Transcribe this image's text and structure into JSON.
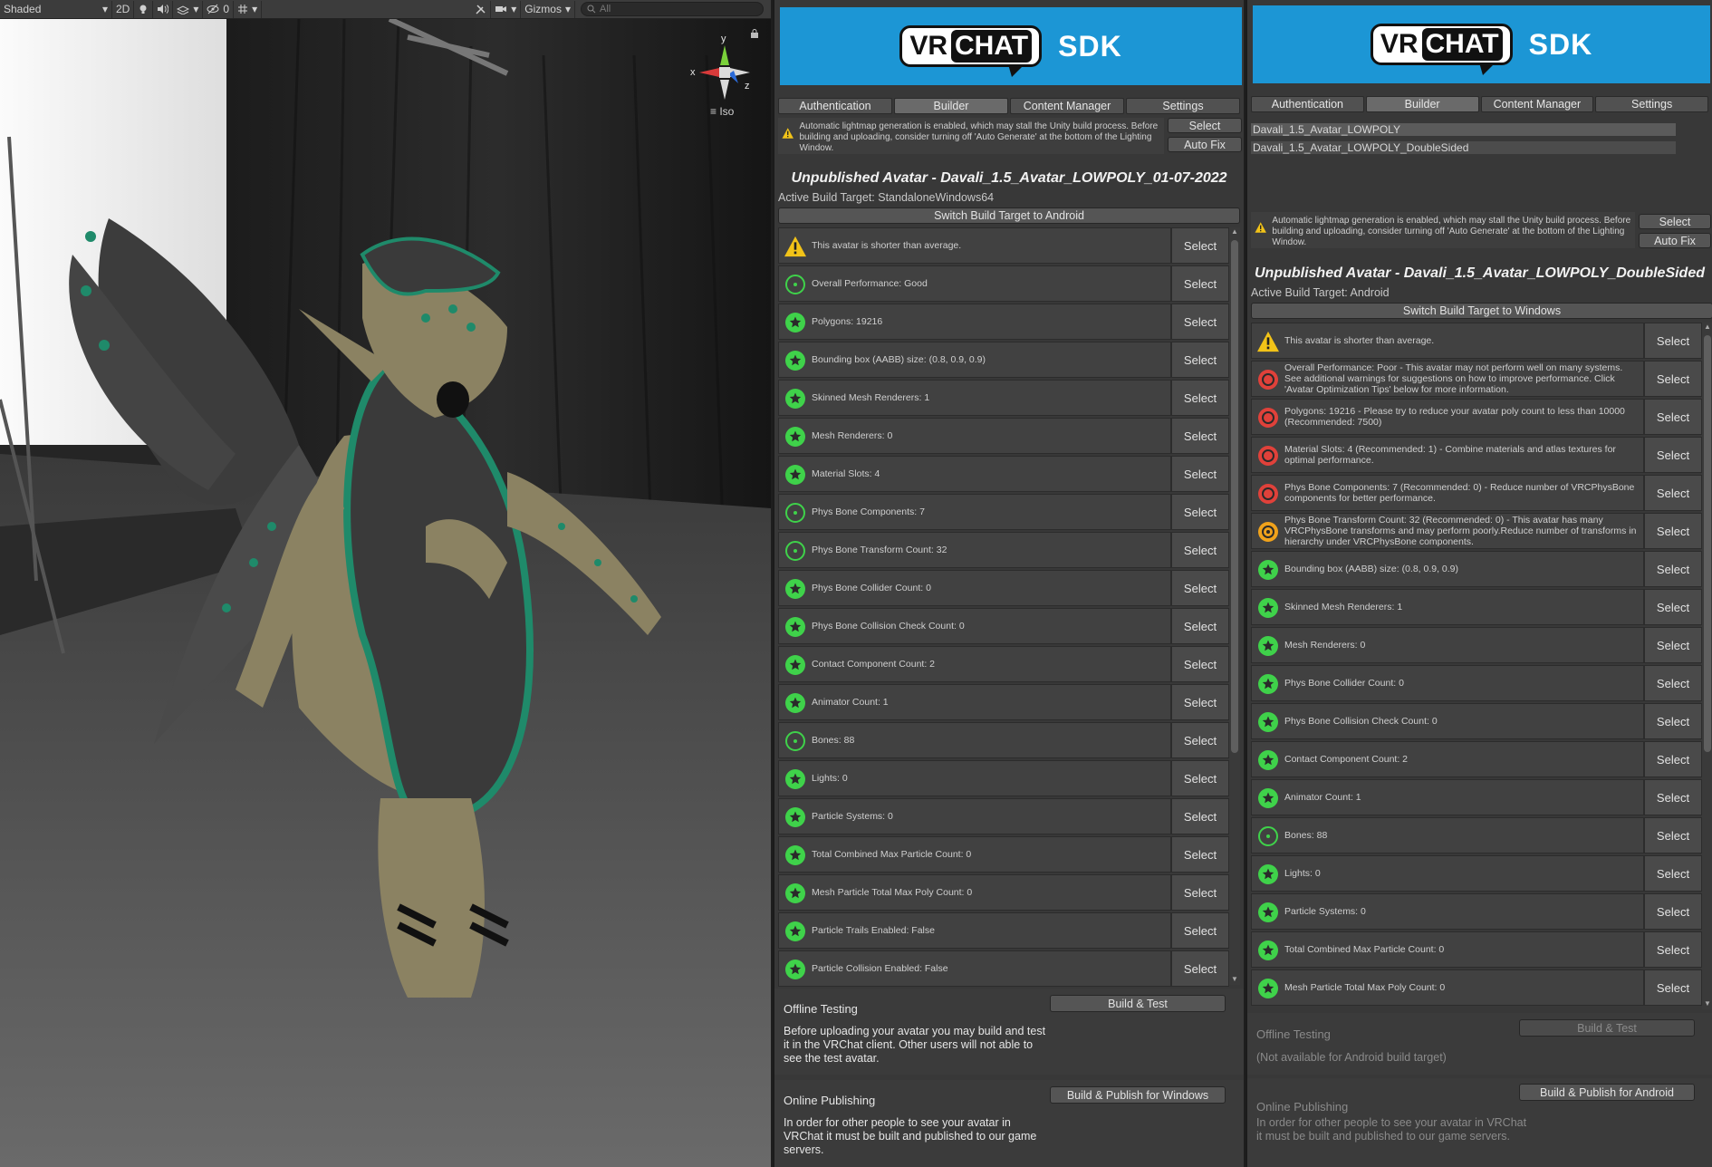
{
  "scene": {
    "toolbar": {
      "shading_mode": "Shaded",
      "mode_2d": "2D",
      "hidden_count": "0",
      "gizmos_label": "Gizmos",
      "search_placeholder": "All"
    },
    "gizmo": {
      "axis_x": "x",
      "axis_y": "y",
      "axis_z": "z",
      "projection": "Iso"
    }
  },
  "panels": [
    {
      "logo_vr": "VR",
      "logo_chat": "CHAT",
      "logo_sdk": "SDK",
      "tabs": [
        "Authentication",
        "Builder",
        "Content Manager",
        "Settings"
      ],
      "active_tab": "Builder",
      "lightmap_warning": "Automatic lightmap generation is enabled, which may stall the Unity build process. Before building and uploading, consider turning off 'Auto Generate' at the bottom of the Lighting Window.",
      "select_label": "Select",
      "autofix_label": "Auto Fix",
      "avatar_title": "Unpublished Avatar - Davali_1.5_Avatar_LOWPOLY_01-07-2022",
      "build_target": "Active Build Target: StandaloneWindows64",
      "switch_label": "Switch Build Target to Android",
      "rows": [
        {
          "status": "warning",
          "text": "This avatar is shorter than average.",
          "button": "Select"
        },
        {
          "status": "good",
          "text": "Overall Performance: Good",
          "button": "Select"
        },
        {
          "status": "excellent",
          "text": "Polygons: 19216",
          "button": "Select"
        },
        {
          "status": "excellent",
          "text": "Bounding box (AABB) size: (0.8, 0.9, 0.9)",
          "button": "Select"
        },
        {
          "status": "excellent",
          "text": "Skinned Mesh Renderers: 1",
          "button": "Select"
        },
        {
          "status": "excellent",
          "text": "Mesh Renderers: 0",
          "button": "Select"
        },
        {
          "status": "excellent",
          "text": "Material Slots: 4",
          "button": "Select"
        },
        {
          "status": "good",
          "text": "Phys Bone Components: 7",
          "button": "Select"
        },
        {
          "status": "good",
          "text": "Phys Bone Transform Count: 32",
          "button": "Select"
        },
        {
          "status": "excellent",
          "text": "Phys Bone Collider Count: 0",
          "button": "Select"
        },
        {
          "status": "excellent",
          "text": "Phys Bone Collision Check Count: 0",
          "button": "Select"
        },
        {
          "status": "excellent",
          "text": "Contact Component Count: 2",
          "button": "Select"
        },
        {
          "status": "excellent",
          "text": "Animator Count: 1",
          "button": "Select"
        },
        {
          "status": "good",
          "text": "Bones: 88",
          "button": "Select"
        },
        {
          "status": "excellent",
          "text": "Lights: 0",
          "button": "Select"
        },
        {
          "status": "excellent",
          "text": "Particle Systems: 0",
          "button": "Select"
        },
        {
          "status": "excellent",
          "text": "Total Combined Max Particle Count: 0",
          "button": "Select"
        },
        {
          "status": "excellent",
          "text": "Mesh Particle Total Max Poly Count: 0",
          "button": "Select"
        },
        {
          "status": "excellent",
          "text": "Particle Trails Enabled: False",
          "button": "Select"
        },
        {
          "status": "excellent",
          "text": "Particle Collision Enabled: False",
          "button": "Select"
        }
      ],
      "offline": {
        "heading": "Offline Testing",
        "button": "Build & Test",
        "description": "Before uploading your avatar you may build and test it in the VRChat client. Other users will not able to see the test avatar."
      },
      "online": {
        "heading": "Online Publishing",
        "button": "Build & Publish for Windows",
        "description": "In order for other people to see your avatar in VRChat it must be built and published to our game servers."
      }
    },
    {
      "logo_vr": "VR",
      "logo_chat": "CHAT",
      "logo_sdk": "SDK",
      "tabs": [
        "Authentication",
        "Builder",
        "Content Manager",
        "Settings"
      ],
      "active_tab": "Builder",
      "avatars": [
        "Davali_1.5_Avatar_LOWPOLY",
        "Davali_1.5_Avatar_LOWPOLY_DoubleSided"
      ],
      "lightmap_warning": "Automatic lightmap generation is enabled, which may stall the Unity build process. Before building and uploading, consider turning off 'Auto Generate' at the bottom of the Lighting Window.",
      "select_label": "Select",
      "autofix_label": "Auto Fix",
      "avatar_title": "Unpublished Avatar - Davali_1.5_Avatar_LOWPOLY_DoubleSided",
      "build_target": "Active Build Target: Android",
      "switch_label": "Switch Build Target to Windows",
      "rows": [
        {
          "status": "warning",
          "text": "This avatar is shorter than average.",
          "button": "Select"
        },
        {
          "status": "poor",
          "text": "Overall Performance: Poor - This avatar may not perform well on many systems. See additional warnings for suggestions on how to improve performance. Click 'Avatar Optimization Tips' below for more information.",
          "button": "Select"
        },
        {
          "status": "poor",
          "text": "Polygons: 19216 - Please try to reduce your avatar poly count to less than 10000 (Recommended: 7500)",
          "button": "Select"
        },
        {
          "status": "poor",
          "text": "Material Slots: 4 (Recommended: 1) - Combine materials and atlas textures for optimal performance.",
          "button": "Select"
        },
        {
          "status": "poor",
          "text": "Phys Bone Components: 7 (Recommended: 0) - Reduce number of VRCPhysBone components for better performance.",
          "button": "Select"
        },
        {
          "status": "medium",
          "text": "Phys Bone Transform Count: 32 (Recommended: 0) - This avatar has many VRCPhysBone transforms and may perform poorly.Reduce number of transforms in hierarchy under VRCPhysBone components.",
          "button": "Select"
        },
        {
          "status": "excellent",
          "text": "Bounding box (AABB) size: (0.8, 0.9, 0.9)",
          "button": "Select"
        },
        {
          "status": "excellent",
          "text": "Skinned Mesh Renderers: 1",
          "button": "Select"
        },
        {
          "status": "excellent",
          "text": "Mesh Renderers: 0",
          "button": "Select"
        },
        {
          "status": "excellent",
          "text": "Phys Bone Collider Count: 0",
          "button": "Select"
        },
        {
          "status": "excellent",
          "text": "Phys Bone Collision Check Count: 0",
          "button": "Select"
        },
        {
          "status": "excellent",
          "text": "Contact Component Count: 2",
          "button": "Select"
        },
        {
          "status": "excellent",
          "text": "Animator Count: 1",
          "button": "Select"
        },
        {
          "status": "good",
          "text": "Bones: 88",
          "button": "Select"
        },
        {
          "status": "excellent",
          "text": "Lights: 0",
          "button": "Select"
        },
        {
          "status": "excellent",
          "text": "Particle Systems: 0",
          "button": "Select"
        },
        {
          "status": "excellent",
          "text": "Total Combined Max Particle Count: 0",
          "button": "Select"
        },
        {
          "status": "excellent",
          "text": "Mesh Particle Total Max Poly Count: 0",
          "button": "Select"
        }
      ],
      "offline": {
        "heading": "Offline Testing",
        "button": "Build & Test",
        "description": "(Not available for Android build target)"
      },
      "online": {
        "heading": "Online Publishing",
        "button": "Build & Publish for Android",
        "description": "In order for other people to see your avatar in VRChat it must be built and published to our game servers."
      }
    }
  ],
  "colors": {
    "banner": "#1c96d5",
    "excellent": "#3fd24a",
    "good": "#3fd24a",
    "poor": "#e0413a",
    "medium": "#f0a21b",
    "warning": "#f2c318"
  }
}
